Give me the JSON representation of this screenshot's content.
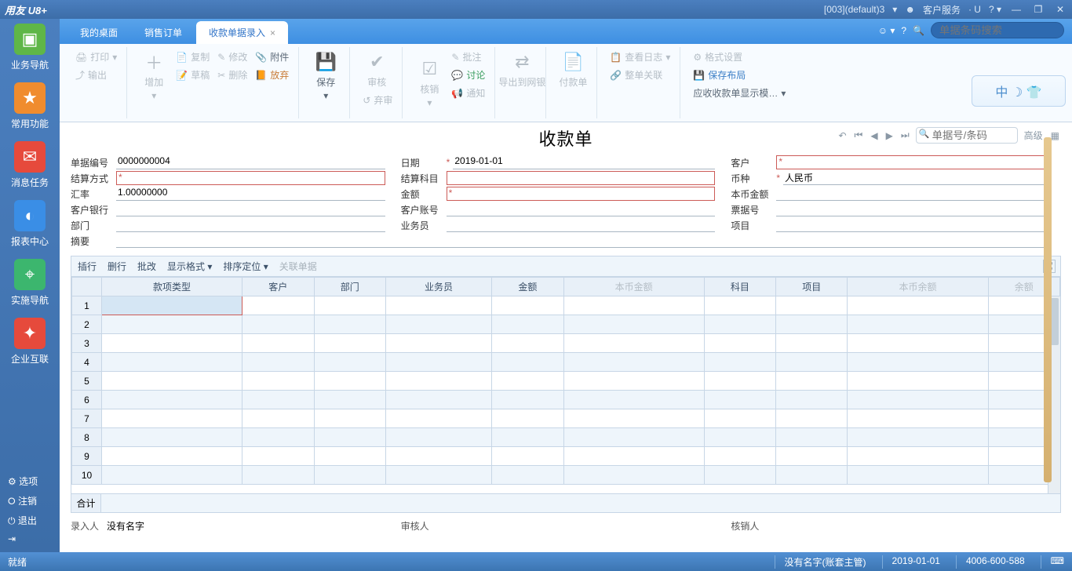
{
  "titlebar": {
    "brand": "用友 U8+",
    "account": "[003](default)3",
    "service": "客户服务"
  },
  "sidebar": {
    "items": [
      {
        "label": "业务导航",
        "color": "#5fb648",
        "glyph": "▣"
      },
      {
        "label": "常用功能",
        "color": "#f08c2e",
        "glyph": "★"
      },
      {
        "label": "消息任务",
        "color": "#e64a3c",
        "glyph": "✉"
      },
      {
        "label": "报表中心",
        "color": "#3a8ee6",
        "glyph": "◐"
      },
      {
        "label": "实施导航",
        "color": "#3cb66e",
        "glyph": "⌖"
      },
      {
        "label": "企业互联",
        "color": "#e64a3c",
        "glyph": "✦"
      }
    ],
    "bottom": [
      "选项",
      "注销",
      "退出"
    ]
  },
  "tabs": {
    "items": [
      {
        "label": "我的桌面",
        "active": false
      },
      {
        "label": "销售订单",
        "active": false
      },
      {
        "label": "收款单据录入",
        "active": true
      }
    ],
    "search_placeholder": "单据条码搜索"
  },
  "ribbon": {
    "g1": {
      "print": "打印",
      "output": "输出"
    },
    "g2": {
      "add": "增加",
      "copy": "复制",
      "draft": "草稿",
      "modify": "修改",
      "delete": "删除",
      "attach": "附件",
      "discard": "放弃"
    },
    "g3": {
      "save": "保存"
    },
    "g4": {
      "audit": "审核",
      "abandon": "弃审"
    },
    "g5": {
      "check": "核销",
      "approve": "批注",
      "discuss": "讨论",
      "notify": "通知"
    },
    "g6": {
      "export": "导出到网银"
    },
    "g7": {
      "pay": "付款单"
    },
    "g8": {
      "log": "查看日志",
      "close_all": "整单关联"
    },
    "g9": {
      "format": "格式设置",
      "save_layout": "保存布局",
      "display": "应收收款单显示模…"
    }
  },
  "doc": {
    "title": "收款单",
    "search_placeholder": "单据号/条码",
    "advanced": "高级",
    "fields": {
      "number_l": "单据编号",
      "number_v": "0000000004",
      "date_l": "日期",
      "date_v": "2019-01-01",
      "customer_l": "客户",
      "customer_v": "",
      "settle_l": "结算方式",
      "settle_v": "",
      "subject_l": "结算科目",
      "subject_v": "",
      "currency_l": "币种",
      "currency_v": "人民币",
      "rate_l": "汇率",
      "rate_v": "1.00000000",
      "amount_l": "金额",
      "amount_v": "",
      "local_l": "本币金额",
      "local_v": "",
      "bank_l": "客户银行",
      "bank_v": "",
      "acct_l": "客户账号",
      "acct_v": "",
      "bill_l": "票据号",
      "bill_v": "",
      "dept_l": "部门",
      "dept_v": "",
      "bus_l": "业务员",
      "bus_v": "",
      "proj_l": "项目",
      "proj_v": "",
      "memo_l": "摘要",
      "memo_v": ""
    }
  },
  "grid_bar": {
    "insert": "插行",
    "delete": "删行",
    "batch": "批改",
    "display": "显示格式",
    "sort": "排序定位",
    "assoc": "关联单据"
  },
  "grid": {
    "columns": [
      "款项类型",
      "客户",
      "部门",
      "业务员",
      "金额",
      "本币金额",
      "科目",
      "项目",
      "本币余额",
      "余额"
    ],
    "total": "合计"
  },
  "reviewers": {
    "enter_l": "录入人",
    "enter_v": "没有名字",
    "audit_l": "审核人",
    "audit_v": "",
    "verify_l": "核销人",
    "verify_v": ""
  },
  "status": {
    "ready": "就绪",
    "user": "没有名字(账套主管)",
    "date": "2019-01-01",
    "phone": "4006-600-588"
  }
}
